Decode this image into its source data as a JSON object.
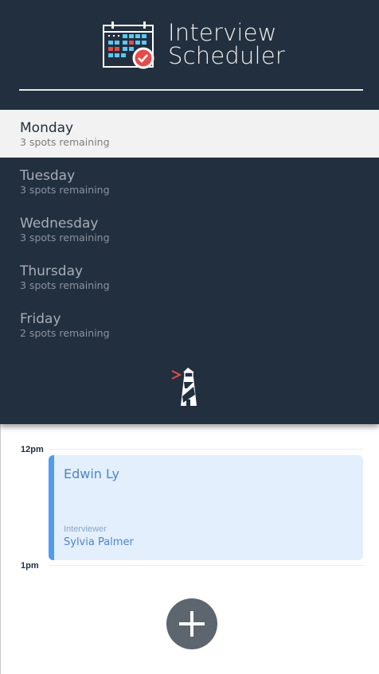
{
  "app": {
    "title_line1": "Interview",
    "title_line2": "Scheduler",
    "logo_icon": "calendar-check-icon",
    "footer_icon": "lighthouse-icon"
  },
  "days": [
    {
      "name": "Monday",
      "spots": "3 spots remaining",
      "selected": true
    },
    {
      "name": "Tuesday",
      "spots": "3 spots remaining",
      "selected": false
    },
    {
      "name": "Wednesday",
      "spots": "3 spots remaining",
      "selected": false
    },
    {
      "name": "Thursday",
      "spots": "3 spots remaining",
      "selected": false
    },
    {
      "name": "Friday",
      "spots": "2 spots remaining",
      "selected": false
    }
  ],
  "schedule": {
    "slot_start": "12pm",
    "slot_end": "1pm",
    "appointment": {
      "student": "Edwin Ly",
      "interviewer_label": "Interviewer",
      "interviewer": "Sylvia Palmer"
    },
    "add_icon": "plus-icon"
  },
  "colors": {
    "sidebar": "#222f3e",
    "selected_day": "#f2f2f2",
    "appointment_bg": "#e3effc",
    "appointment_accent": "#4e9bf0",
    "add_button": "#5d666f"
  }
}
